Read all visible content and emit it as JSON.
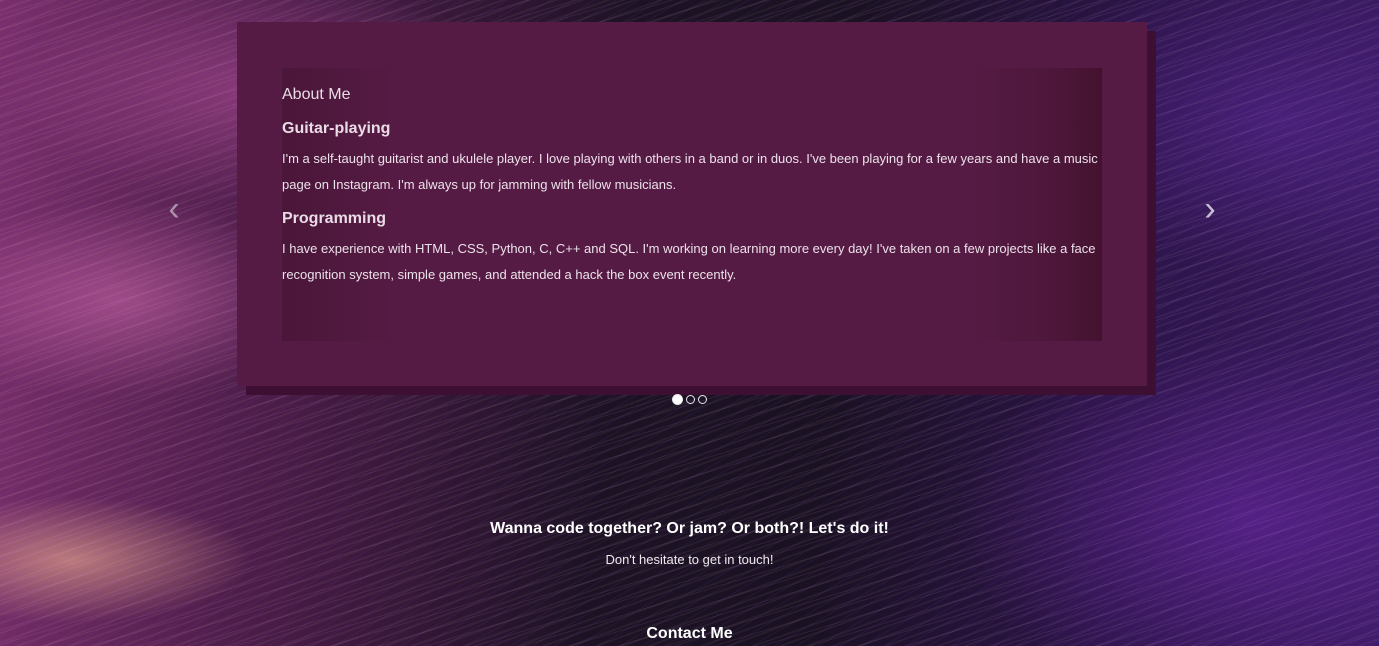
{
  "about": {
    "title": "About Me",
    "sections": [
      {
        "heading": "Guitar-playing",
        "text": "I'm a self-taught guitarist and ukulele player. I love playing with others in a band or in duos. I've been playing for a few years and have a music page on Instagram. I'm always up for jamming with fellow musicians."
      },
      {
        "heading": "Programming",
        "text": "I have experience with HTML, CSS, Python, C, C++ and SQL. I'm working on learning more every day! I've taken on a few projects like a face recognition system, simple games, and attended a hack the box event recently."
      }
    ]
  },
  "carousel": {
    "prev_icon": "chevron-left-icon",
    "next_icon": "chevron-right-icon",
    "prev_glyph": "‹",
    "next_glyph": "›",
    "active_index": 0,
    "slide_count": 3
  },
  "cta": {
    "heading": "Wanna code together? Or jam? Or both?! Let's do it!",
    "subtext": "Don't hesitate to get in touch!"
  },
  "contact": {
    "heading": "Contact Me"
  },
  "colors": {
    "card_bg": "#561b44",
    "card_shadow": "#3d0f32"
  }
}
